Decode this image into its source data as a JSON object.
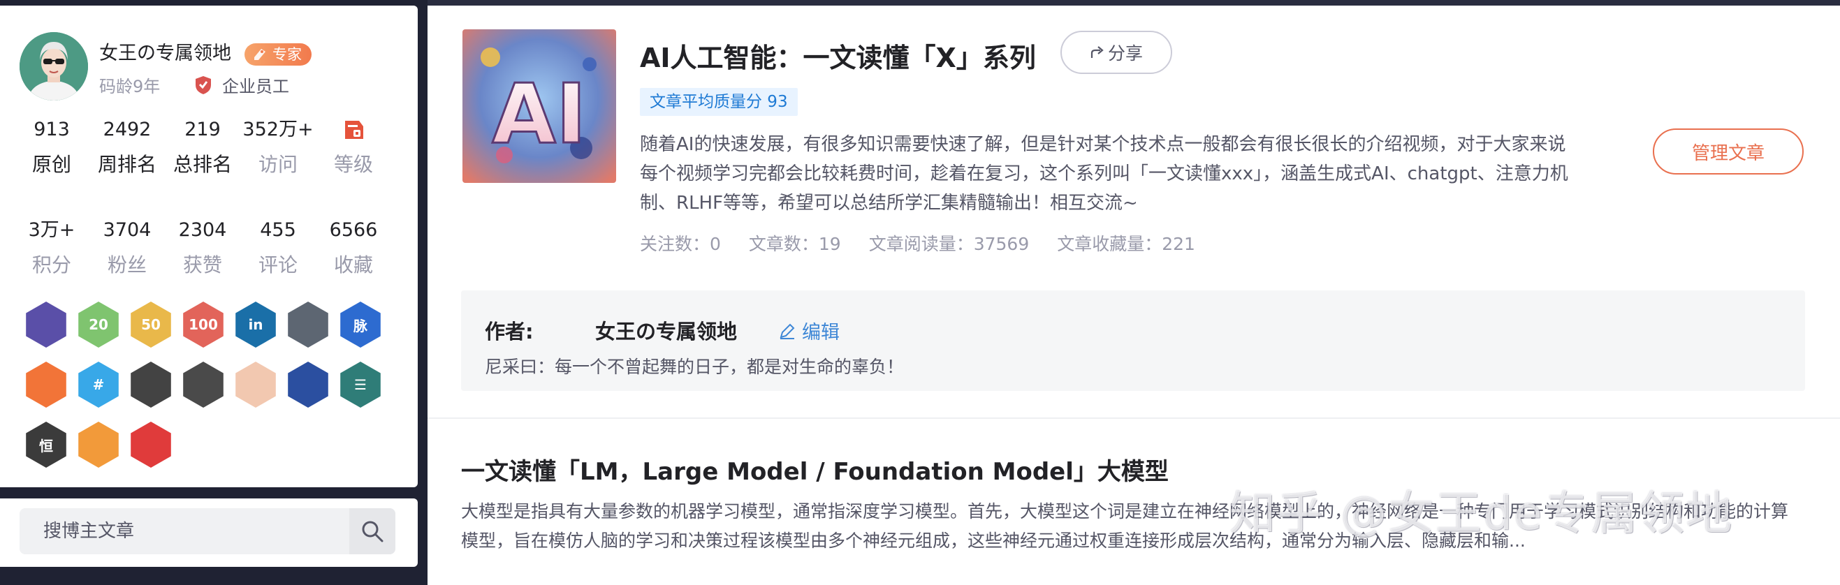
{
  "profile": {
    "name": "女王の专属领地",
    "badge": "专家",
    "code_age": "码龄9年",
    "employee": "企业员工",
    "stats_row1": [
      {
        "value": "913",
        "label": "原创"
      },
      {
        "value": "2492",
        "label": "周排名"
      },
      {
        "value": "219",
        "label": "总排名"
      },
      {
        "value": "352万+",
        "label": "访问"
      },
      {
        "value": "",
        "label": "等级",
        "icon": "level-icon"
      }
    ],
    "stats_row2": [
      {
        "value": "3万+",
        "label": "积分"
      },
      {
        "value": "3704",
        "label": "粉丝"
      },
      {
        "value": "2304",
        "label": "获赞"
      },
      {
        "value": "455",
        "label": "评论"
      },
      {
        "value": "6566",
        "label": "收藏"
      }
    ],
    "badges": [
      {
        "name": "badge-graduation-icon",
        "color": "#5a4fa8",
        "text": ""
      },
      {
        "name": "badge-20-icon",
        "color": "#7fc46f",
        "text": "20"
      },
      {
        "name": "badge-50-icon",
        "color": "#e9b84a",
        "text": "50"
      },
      {
        "name": "badge-100-icon",
        "color": "#e2645a",
        "text": "100"
      },
      {
        "name": "badge-linkedin-icon",
        "color": "#1a6fa8",
        "text": "in"
      },
      {
        "name": "badge-github-icon",
        "color": "#5d6672",
        "text": ""
      },
      {
        "name": "badge-mai-icon",
        "color": "#2d6bd0",
        "text": "脉"
      },
      {
        "name": "badge-trophy-icon",
        "color": "#f27438",
        "text": ""
      },
      {
        "name": "badge-hashtag-icon",
        "color": "#38a8e8",
        "text": "#"
      },
      {
        "name": "badge-medal-icon",
        "color": "#434343",
        "text": ""
      },
      {
        "name": "badge-2020-icon",
        "color": "#4a4a4a",
        "text": ""
      },
      {
        "name": "badge-monkey-icon",
        "color": "#f2c8b0",
        "text": ""
      },
      {
        "name": "badge-rocket-icon",
        "color": "#2b4fa0",
        "text": ""
      },
      {
        "name": "badge-list-icon",
        "color": "#2f7d78",
        "text": "☰"
      },
      {
        "name": "badge-heng-icon",
        "color": "#3b3b3b",
        "text": "恒"
      },
      {
        "name": "badge-book-icon",
        "color": "#f29a3a",
        "text": ""
      },
      {
        "name": "badge-pen-icon",
        "color": "#e03b3b",
        "text": ""
      }
    ]
  },
  "search": {
    "placeholder": "搜博主文章"
  },
  "column": {
    "title": "AI人工智能：一文读懂「X」系列",
    "share_label": "分享",
    "quality": "文章平均质量分 93",
    "description": "随着AI的快速发展，有很多知识需要快速了解，但是针对某个技术点一般都会有很长很长的介绍视频，对于大家来说每个视频学习完都会比较耗费时间，趁着在复习，这个系列叫「一文读懂xxx」，涵盖生成式AI、chatgpt、注意力机制、RLHF等等，希望可以总结所学汇集精髓输出！相互交流~",
    "meta": {
      "followers": "关注数：0",
      "articles": "文章数：19",
      "reads": "文章阅读量：37569",
      "favorites": "文章收藏量：221"
    },
    "manage_label": "管理文章"
  },
  "author_box": {
    "label": "作者:",
    "name": "女王の专属领地",
    "edit_label": "编辑",
    "motto": "尼采曰：每一个不曾起舞的日子，都是对生命的辜负！"
  },
  "article": {
    "title": "一文读懂「LM，Large Model / Foundation Model」大模型",
    "summary": "大模型是指具有大量参数的机器学习模型，通常指深度学习模型。首先，大模型这个词是建立在神经网络模型上的，神经网络是一种专门用于学习模式识别结构和功能的计算模型，旨在模仿人脑的学习和决策过程该模型由多个神经元组成，这些神经元通过权重连接形成层次结构，通常分为输入层、隐藏层和输..."
  },
  "watermark": "知乎 @女王de专属领地",
  "colors": {
    "accent_orange": "#e9704f",
    "link_blue": "#3e87d6",
    "quality_blue": "#1e7ad4"
  }
}
